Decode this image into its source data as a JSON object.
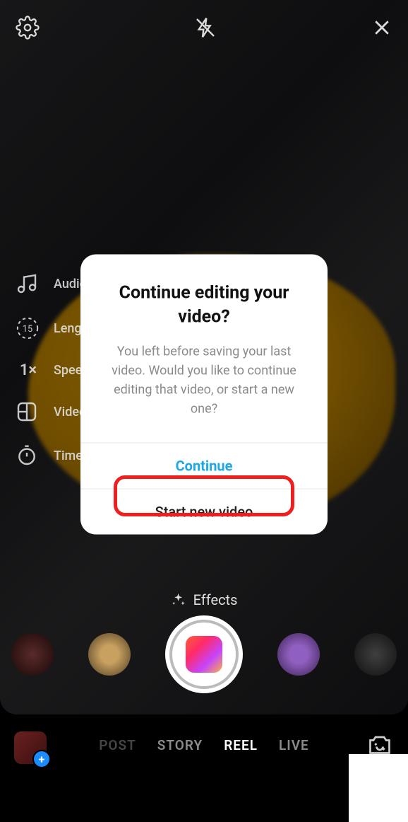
{
  "top": {
    "settings_icon": "settings",
    "flash_icon": "flash-off",
    "close_icon": "close"
  },
  "side": [
    {
      "icon": "music",
      "label": "Audio"
    },
    {
      "icon": "timer-15",
      "text": "15",
      "label": "Length"
    },
    {
      "icon": "speed",
      "text": "1×",
      "label": "Speed"
    },
    {
      "icon": "layout",
      "label": "Video layout"
    },
    {
      "icon": "stopwatch",
      "label": "Timer"
    }
  ],
  "effects_label": "Effects",
  "modes": {
    "items": [
      "POST",
      "STORY",
      "REEL",
      "LIVE"
    ],
    "active": 2
  },
  "modal": {
    "title": "Continue editing your video?",
    "body": "You left before saving your last video. Would you like to continue editing that video, or start a new one?",
    "primary": "Continue",
    "secondary": "Start new video"
  }
}
